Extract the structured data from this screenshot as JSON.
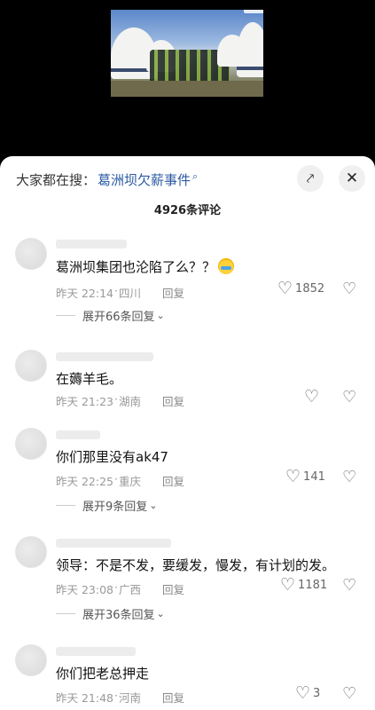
{
  "search": {
    "prefix": "大家都在搜：",
    "term": "葛洲坝欠薪事件"
  },
  "header": {
    "comment_count": "4926条评论",
    "expand_icon": "collapse-arrows-icon",
    "close_icon": "close-icon"
  },
  "comments": [
    {
      "text": "葛洲坝集团也沦陷了么？？",
      "emoji": "crying-laughing-emoji",
      "time": "昨天 22:14",
      "location": "四川",
      "reply": "回复",
      "likes": "1852",
      "replies_label": "展开66条回复"
    },
    {
      "text": "在薅羊毛。",
      "time": "昨天 21:23",
      "location": "湖南",
      "reply": "回复",
      "likes": "",
      "replies_label": ""
    },
    {
      "text": "你们那里没有ak47",
      "time": "昨天 22:25",
      "location": "重庆",
      "reply": "回复",
      "likes": "141",
      "replies_label": "展开9条回复"
    },
    {
      "text": "领导：不是不发，要缓发，慢发，有计划的发。",
      "time": "昨天 23:08",
      "location": "广西",
      "reply": "回复",
      "likes": "1181",
      "replies_label": "展开36条回复"
    },
    {
      "text": "你们把老总押走",
      "time": "昨天 21:48",
      "location": "河南",
      "reply": "回复",
      "likes": "3",
      "replies_label": ""
    }
  ],
  "colors": {
    "search_term": "#2b5aa3",
    "sheet_bg": "#ffffff",
    "page_bg": "#000000"
  }
}
